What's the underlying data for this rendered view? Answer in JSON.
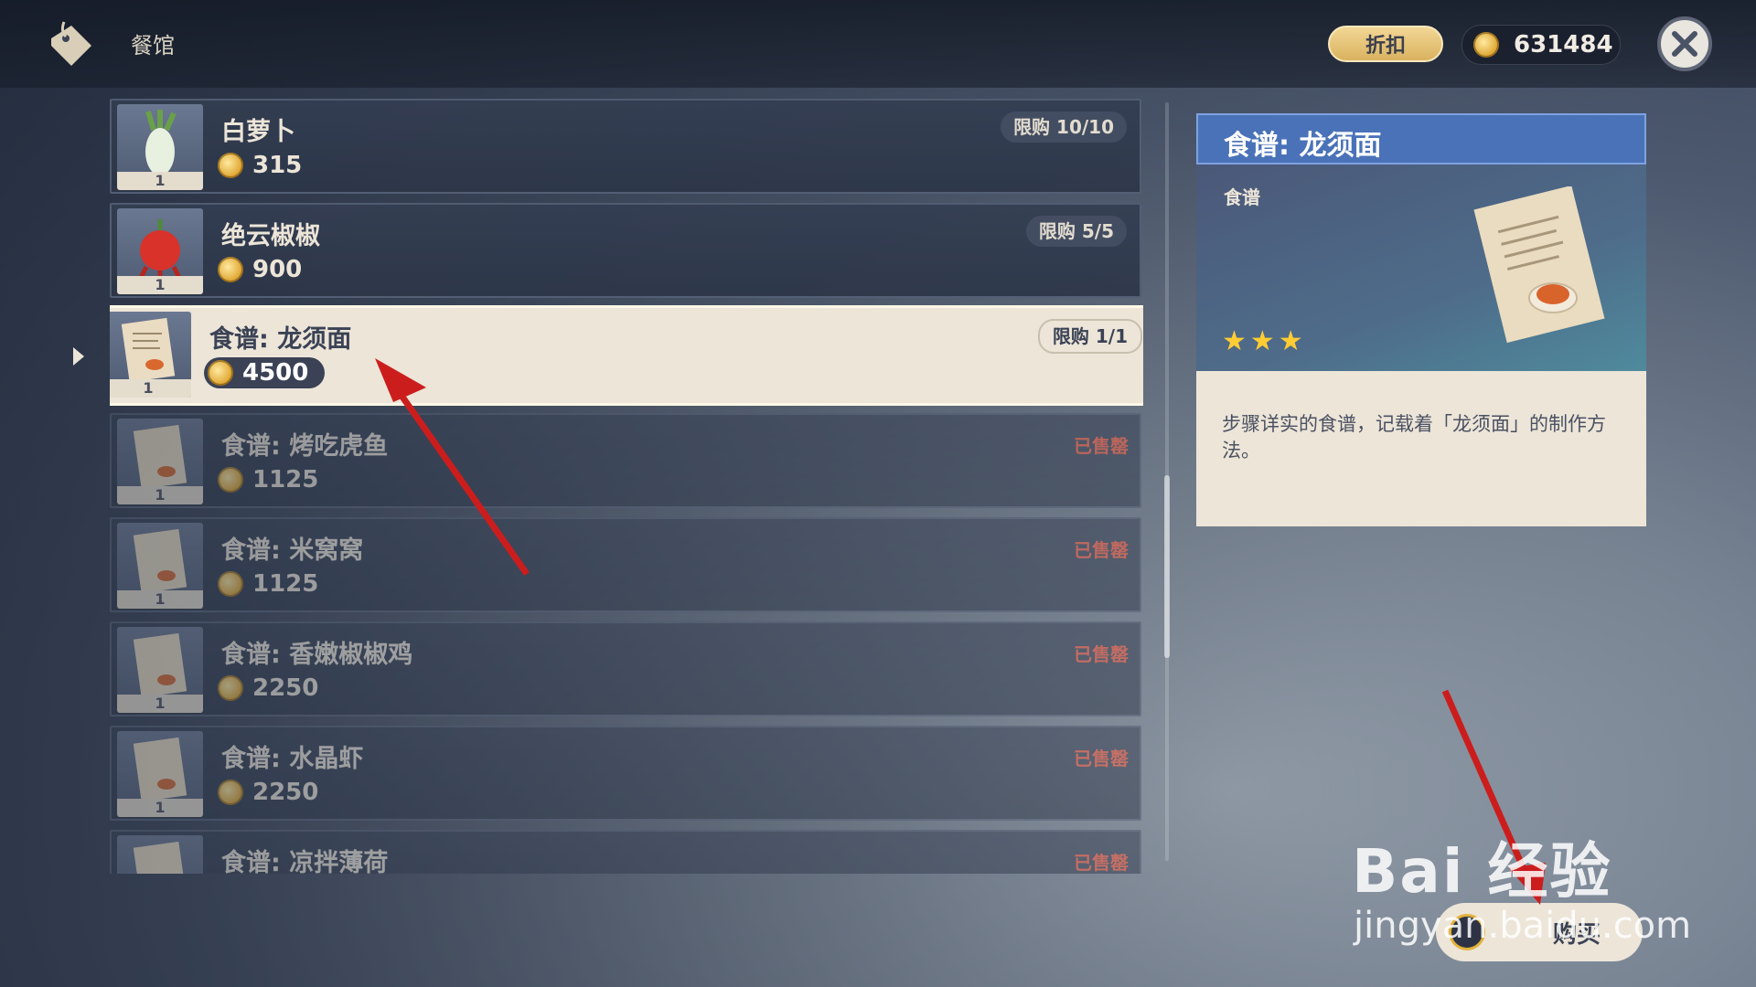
{
  "header": {
    "shop_name": "餐馆",
    "discount_label": "折扣",
    "mora": "631484"
  },
  "items": [
    {
      "name": "白萝卜",
      "price": "315",
      "qty": "1",
      "limit": "限购 10/10"
    },
    {
      "name": "绝云椒椒",
      "price": "900",
      "qty": "1",
      "limit": "限购 5/5"
    },
    {
      "name": "食谱: 龙须面",
      "price": "4500",
      "qty": "1",
      "limit": "限购 1/1"
    },
    {
      "name": "食谱: 烤吃虎鱼",
      "price": "1125",
      "qty": "1",
      "status": "已售罄"
    },
    {
      "name": "食谱: 米窝窝",
      "price": "1125",
      "qty": "1",
      "status": "已售罄"
    },
    {
      "name": "食谱: 香嫩椒椒鸡",
      "price": "2250",
      "qty": "1",
      "status": "已售罄"
    },
    {
      "name": "食谱: 水晶虾",
      "price": "2250",
      "qty": "1",
      "status": "已售罄"
    },
    {
      "name": "食谱: 凉拌薄荷",
      "status": "已售罄"
    }
  ],
  "detail": {
    "title": "食谱: 龙须面",
    "category": "食谱",
    "stars": "★★★",
    "description": "步骤详实的食谱，记载着「龙须面」的制作方法。"
  },
  "buy_label": "购买",
  "watermark": {
    "line1": "Bai 经验",
    "line2": "jingyan.baidu.com"
  },
  "colors": {
    "accent": "#4a72b8",
    "sold_out": "#ff5a3c",
    "selected_bg": "#ece5d8"
  }
}
